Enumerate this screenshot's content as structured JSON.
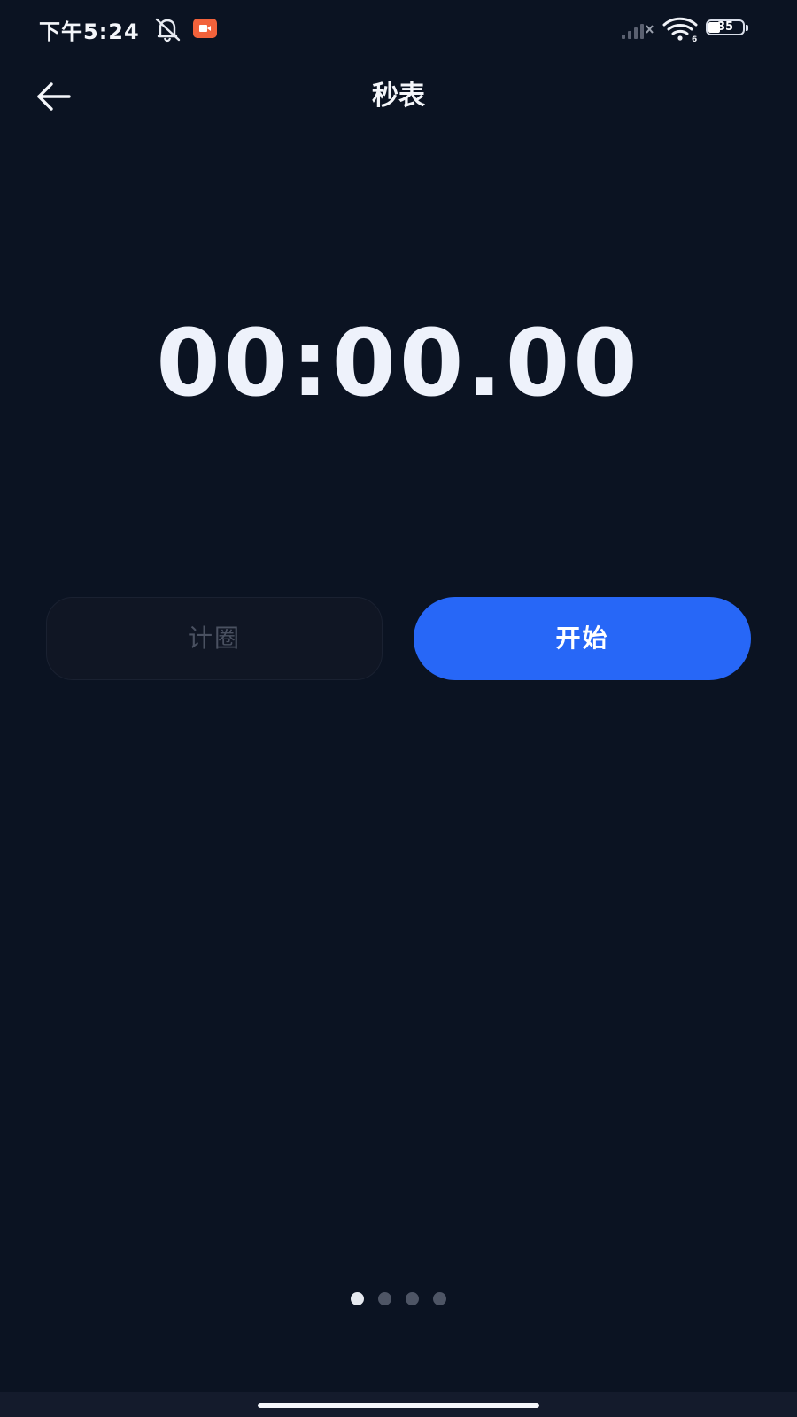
{
  "status_bar": {
    "time": "下午5:24",
    "battery": "35",
    "wifi_badge": "6",
    "icons": [
      "bell-muted-icon",
      "screen-record-icon",
      "signal-icon",
      "wifi-icon",
      "battery-icon"
    ]
  },
  "header": {
    "title": "秒表",
    "back_icon": "arrow-left-icon"
  },
  "timer": {
    "display": "00:00.00"
  },
  "buttons": {
    "lap_label": "计圈",
    "start_label": "开始"
  },
  "pager": {
    "count": 4,
    "active_index": 0
  },
  "colors": {
    "background": "#0b1322",
    "accent": "#2767f7",
    "lap_button_bg": "#101624",
    "lap_text": "#4a5161",
    "text": "#f4f6fa",
    "recording_badge": "#f2623b"
  }
}
